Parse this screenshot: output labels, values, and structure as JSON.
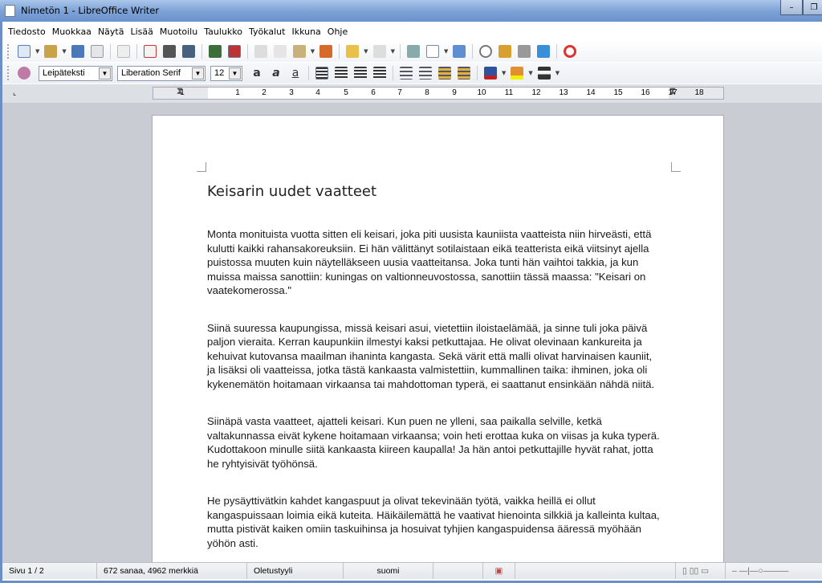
{
  "window": {
    "title": "Nimetön 1 - LibreOffice Writer",
    "minimize": "–",
    "maximize": "❐"
  },
  "menu": [
    "Tiedosto",
    "Muokkaa",
    "Näytä",
    "Lisää",
    "Muotoilu",
    "Taulukko",
    "Työkalut",
    "Ikkuna",
    "Ohje"
  ],
  "formatting": {
    "paragraph_style": "Leipäteksti",
    "font_name": "Liberation Serif",
    "font_size": "12"
  },
  "ruler": {
    "labels": [
      "1",
      "1",
      "2",
      "3",
      "4",
      "5",
      "6",
      "7",
      "8",
      "9",
      "10",
      "11",
      "12",
      "13",
      "14",
      "15",
      "16",
      "17",
      "18"
    ]
  },
  "document": {
    "heading": "Keisarin uudet vaatteet",
    "paragraphs": [
      [
        "Monta monituista vuotta sitten eli keisari, joka piti uusista kauniista vaatteista niin hirveästi, että",
        "kulutti kaikki rahansakoreuksiin. Ei hän välittänyt sotilaistaan eikä teatterista eikä viitsinyt ajella",
        "puistossa muuten kuin näytelläkseen uusia vaatteitansa. Joka tunti hän vaihtoi takkia, ja kun",
        "muissa maissa sanottiin: kuningas on valtionneuvostossa, sanottiin tässä maassa: \"Keisari on",
        "vaatekomerossa.\""
      ],
      [
        "Siinä suuressa kaupungissa, missä keisari asui, vietettiin iloistaelämää, ja sinne tuli joka päivä",
        "paljon vieraita. Kerran kaupunkiin ilmestyi kaksi petkuttajaa. He olivat olevinaan kankureita ja",
        "kehuivat kutovansa maailman ihaninta kangasta. Sekä värit että malli olivat harvinaisen kauniit,",
        "ja lisäksi oli vaatteissa, jotka tästä kankaasta valmistettiin, kummallinen taika: ihminen, joka oli",
        "kykenemätön hoitamaan virkaansa tai mahdottoman typerä, ei saattanut ensinkään nähdä niitä."
      ],
      [
        "Siinäpä vasta vaatteet, ajatteli keisari. Kun puen ne ylleni, saa paikalla selville, ketkä",
        "valtakunnassa eivät kykene hoitamaan virkaansa; voin heti erottaa kuka on viisas ja kuka typerä.",
        "Kudottakoon minulle siitä kankaasta kiireen kaupalla! Ja hän antoi petkuttajille hyvät rahat, jotta",
        "he ryhtyisivät työhönsä."
      ],
      [
        "He pysäyttivätkin kahdet kangaspuut ja olivat tekevinään työtä, vaikka heillä ei ollut",
        "kangaspuissaan loimia eikä kuteita. Häikäilemättä he vaativat hienointa silkkiä ja kalleinta kultaa,",
        "mutta pistivät kaiken omiin taskuihinsa ja hosuivat tyhjien kangaspuidensa ääressä myöhään",
        "yöhön asti."
      ]
    ]
  },
  "status": {
    "page": "Sivu 1 / 2",
    "words": "672 sanaa, 4962 merkkiä",
    "style": "Oletustyyli",
    "language": "suomi"
  }
}
